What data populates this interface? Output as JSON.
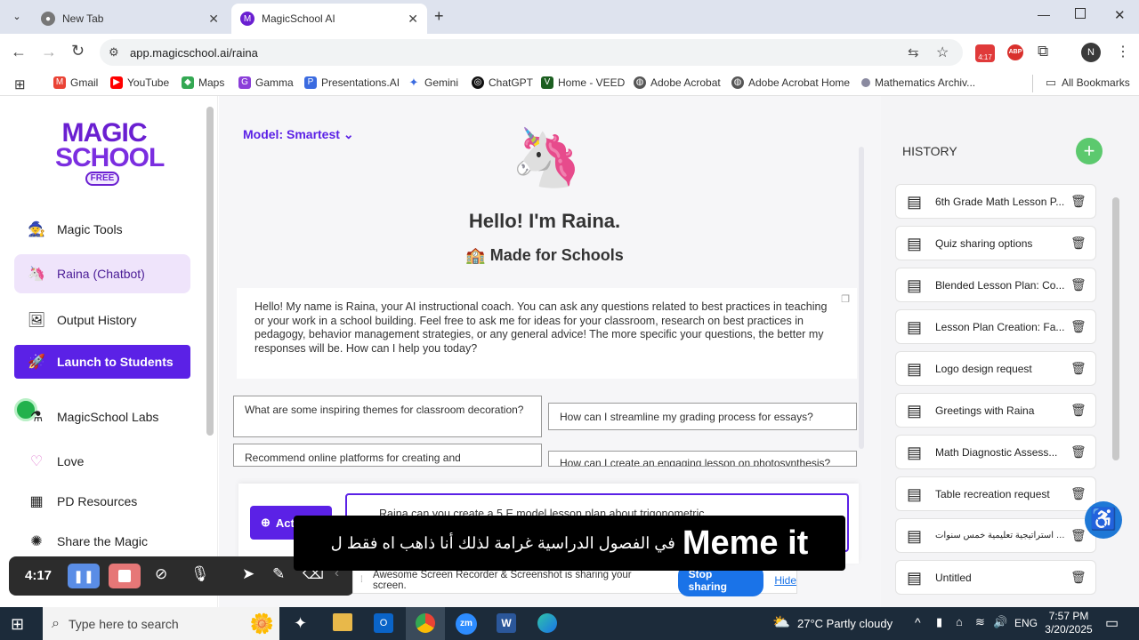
{
  "browser": {
    "tabs": [
      {
        "label": "New Tab"
      },
      {
        "label": "MagicSchool AI"
      }
    ],
    "url": "app.magicschool.ai/raina",
    "ext_badge": "4:17",
    "ext_abp": "ABP",
    "profile": "N",
    "bookmarks": [
      "Gmail",
      "YouTube",
      "Maps",
      "Gamma",
      "Presentations.AI",
      "Gemini",
      "ChatGPT",
      "Home - VEED",
      "Adobe Acrobat",
      "Adobe Acrobat Home",
      "Mathematics Archiv..."
    ],
    "all_bookmarks": "All Bookmarks"
  },
  "sidebar": {
    "logo_line1": "MAGIC",
    "logo_line2": "SCHOOL",
    "logo_badge": "FREE",
    "items": [
      {
        "label": "Magic Tools"
      },
      {
        "label": "Raina (Chatbot)"
      },
      {
        "label": "Output History"
      },
      {
        "label": "Launch to Students"
      },
      {
        "label": "MagicSchool Labs"
      },
      {
        "label": "Love"
      },
      {
        "label": "PD Resources"
      },
      {
        "label": "Share the Magic"
      }
    ]
  },
  "main": {
    "model_label": "Model: Smartest",
    "greeting": "Hello! I'm Raina.",
    "subtitle": "Made for Schools",
    "intro": "Hello! My name is Raina, your AI instructional coach. You can ask any questions related to best practices in teaching or your work in a school building. Feel free to ask me for ideas for your classroom, research on best practices in pedagogy, behavior management strategies, or any general advice! The more specific your questions, the better my responses will be. How can I help you today?",
    "suggestions": [
      "What are some inspiring themes for classroom decoration?",
      "How can I streamline my grading process for essays?",
      "Recommend online platforms for creating and",
      "How can I create an engaging lesson on photosynthesis?"
    ],
    "action_label": "Act",
    "input_value": "Raina can you create a 5 E model lesson plan about trigonometric"
  },
  "history": {
    "title": "HISTORY",
    "items": [
      "6th Grade Math Lesson P...",
      "Quiz sharing options",
      "Blended Lesson Plan: Co...",
      "Lesson Plan Creation: Fa...",
      "Logo design request",
      "Greetings with Raina",
      "Math Diagnostic Assess...",
      "Table recreation request",
      "خطة استراتيجية تعليمية خمس سنوات",
      "Untitled"
    ]
  },
  "overlay": {
    "caption_en": "Meme it",
    "caption_ar": "في الفصول الدراسية غرامة لذلك أنا ذاهب اه فقط ل",
    "recorder_time": "4:17",
    "share_text": "Awesome Screen Recorder & Screenshot is sharing your screen.",
    "stop_label": "Stop sharing",
    "hide_label": "Hide"
  },
  "taskbar": {
    "search_placeholder": "Type here to search",
    "weather": "27°C  Partly cloudy",
    "lang": "ENG",
    "time": "7:57 PM",
    "date": "3/20/2025"
  },
  "colors": {
    "brand": "#6a1fd1",
    "purple_btn": "#5b21e6",
    "green_add": "#5cc96e"
  }
}
